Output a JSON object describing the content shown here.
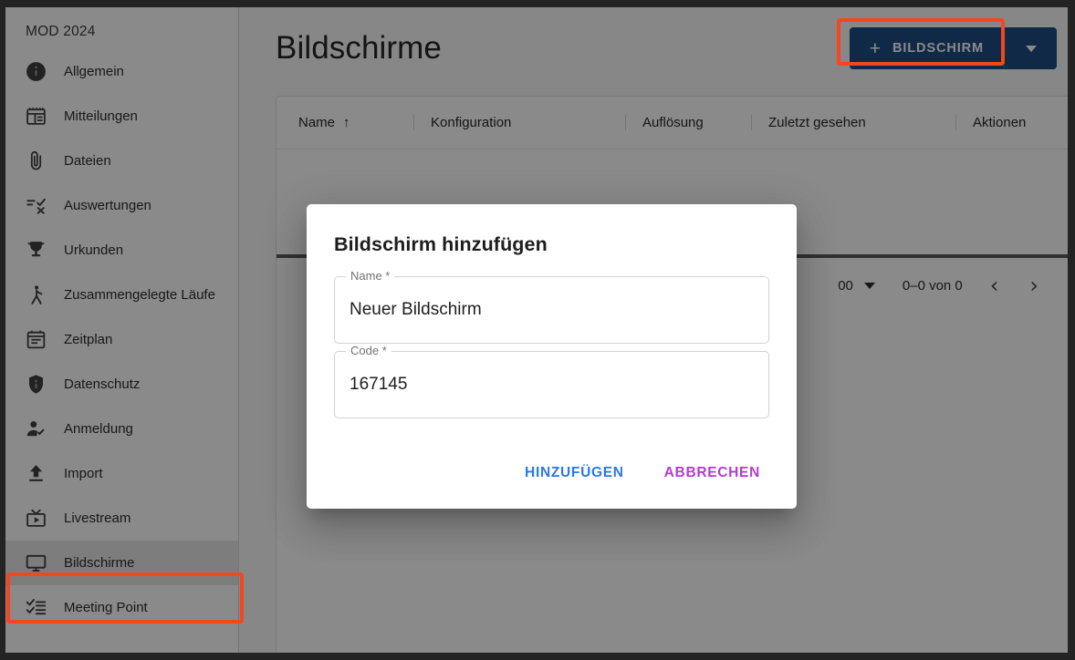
{
  "sidebar": {
    "title": "MOD 2024",
    "items": [
      {
        "label": "Allgemein",
        "icon": "info-circle-icon"
      },
      {
        "label": "Mitteilungen",
        "icon": "news-board-icon"
      },
      {
        "label": "Dateien",
        "icon": "paperclip-icon"
      },
      {
        "label": "Auswertungen",
        "icon": "results-list-icon"
      },
      {
        "label": "Urkunden",
        "icon": "trophy-icon"
      },
      {
        "label": "Zusammengelegte Läufe",
        "icon": "runner-icon"
      },
      {
        "label": "Zeitplan",
        "icon": "calendar-icon"
      },
      {
        "label": "Datenschutz",
        "icon": "shield-info-icon"
      },
      {
        "label": "Anmeldung",
        "icon": "person-check-icon"
      },
      {
        "label": "Import",
        "icon": "upload-icon"
      },
      {
        "label": "Livestream",
        "icon": "tv-play-icon"
      },
      {
        "label": "Bildschirme",
        "icon": "monitor-icon"
      },
      {
        "label": "Meeting Point",
        "icon": "checklist-icon"
      }
    ],
    "selected_index": 11
  },
  "header": {
    "title": "Bildschirme",
    "add_button_label": "BILDSCHIRM",
    "add_button_plus": "+",
    "split_icon": "chevron-down-icon"
  },
  "table": {
    "columns": [
      "Name",
      "Konfiguration",
      "Auflösung",
      "Zuletzt gesehen",
      "Aktionen"
    ],
    "sort_indicator": "↑",
    "sorted_column": "Name",
    "rows": [],
    "footer": {
      "rows_per_page_value": "00",
      "range_label": "0–0 von 0",
      "prev_icon": "chevron-left-icon",
      "next_icon": "chevron-right-icon"
    }
  },
  "dialog": {
    "title": "Bildschirm hinzufügen",
    "fields": [
      {
        "label": "Name *",
        "value": "Neuer Bildschirm"
      },
      {
        "label": "Code *",
        "value": "167145"
      }
    ],
    "confirm_label": "HINZUFÜGEN",
    "cancel_label": "ABBRECHEN"
  },
  "colors": {
    "primary_button": "#1f4d82",
    "annotation": "#f4461f",
    "confirm_text": "#2979e8",
    "cancel_text": "#b43ad2",
    "selected_nav": "#e8e8e8"
  }
}
